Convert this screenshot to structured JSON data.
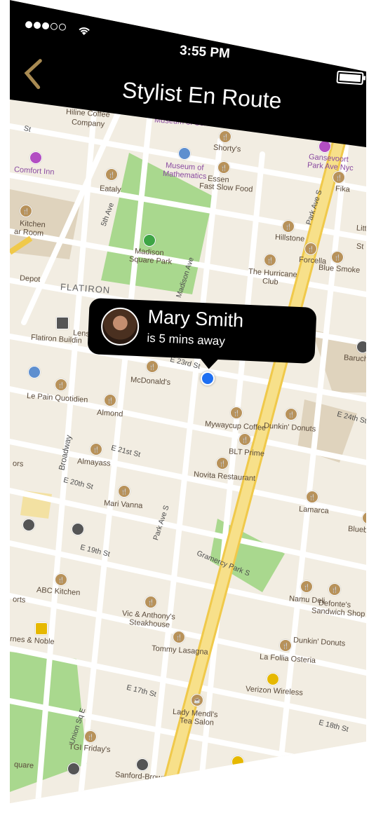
{
  "status_bar": {
    "time": "3:55 PM"
  },
  "nav": {
    "title": "Stylist En Route",
    "back_icon": "chevron-left-icon"
  },
  "callout": {
    "name": "Mary Smith",
    "eta": "is 5 mins away"
  },
  "map": {
    "labels": {
      "hiline": "Hiline Coffee",
      "company": "Company",
      "museum_sex": "Museum of Sex",
      "shortys": "Shorty's",
      "gansevoort": "Gansevoort",
      "gansevoort2": "Park Ave Nyc",
      "comfort_inn": "Comfort Inn",
      "museum_math": "Museum of",
      "museum_math2": "Mathematics",
      "essen": "Essen",
      "essen2": "Fast Slow Food",
      "fika": "Fika",
      "eataly": "Eataly",
      "kitchen": "Kitchen",
      "bar_room": "ar Room",
      "madison_sq": "Madison",
      "madison_sq2": "Square Park",
      "hillstone": "Hillstone",
      "forcella": "Forcella",
      "blue_smoke": "Blue Smoke",
      "hurricane": "The Hurricane",
      "hurricane2": "Club",
      "depot": "Depot",
      "flatiron": "FLATIRON",
      "flatiron_bldg": "Flatiron Buildin",
      "lens": "Lens",
      "baruch": "Baruch C",
      "mcdonalds": "McDonald's",
      "le_pain": "Le Pain Quotidien",
      "almond": "Almond",
      "mywaycup": "Mywaycup Coffee",
      "dunkin1": "Dunkin' Donuts",
      "blt": "BLT Prime",
      "almayass": "Almayass",
      "novita": "Novita Restaurant",
      "ors": "ors",
      "mari_vanna": "Mari Vanna",
      "lamarca": "Lamarca",
      "bluebe": "Bluebe",
      "abc": "ABC Kitchen",
      "namu": "Namu Deli",
      "defonte": "Defonte's",
      "defonte2": "Sandwich Shop",
      "orts": "orts",
      "vic": "Vic & Anthony's",
      "vic2": "Steakhouse",
      "rnes": "rnes & Noble",
      "tommy": "Tommy Lasagna",
      "dunkin2": "Dunkin' Donuts",
      "follia": "La Follia Osteria",
      "verizon": "Verizon Wireless",
      "lady": "Lady Mendl's",
      "lady2": "Tea Salon",
      "tgi": "TGI Friday's",
      "quare": "quare",
      "sanford": "Sanford-Brown",
      "litt": "Litt",
      "st": "St"
    },
    "streets": {
      "e23": "E 23rd St",
      "e24": "E 24th St",
      "e21": "E 21st St",
      "e20": "E 20th St",
      "e19": "E 19th St",
      "e18": "E 18th St",
      "e17": "E 17th St",
      "broadway": "Broadway",
      "fifth": "5th Ave",
      "madison": "Madison Ave",
      "park_s_top": "Park Ave S",
      "park_s": "Park Ave S",
      "gramercy": "Gramercy Park S",
      "union": "Union Sq E",
      "st_top": "St"
    }
  }
}
